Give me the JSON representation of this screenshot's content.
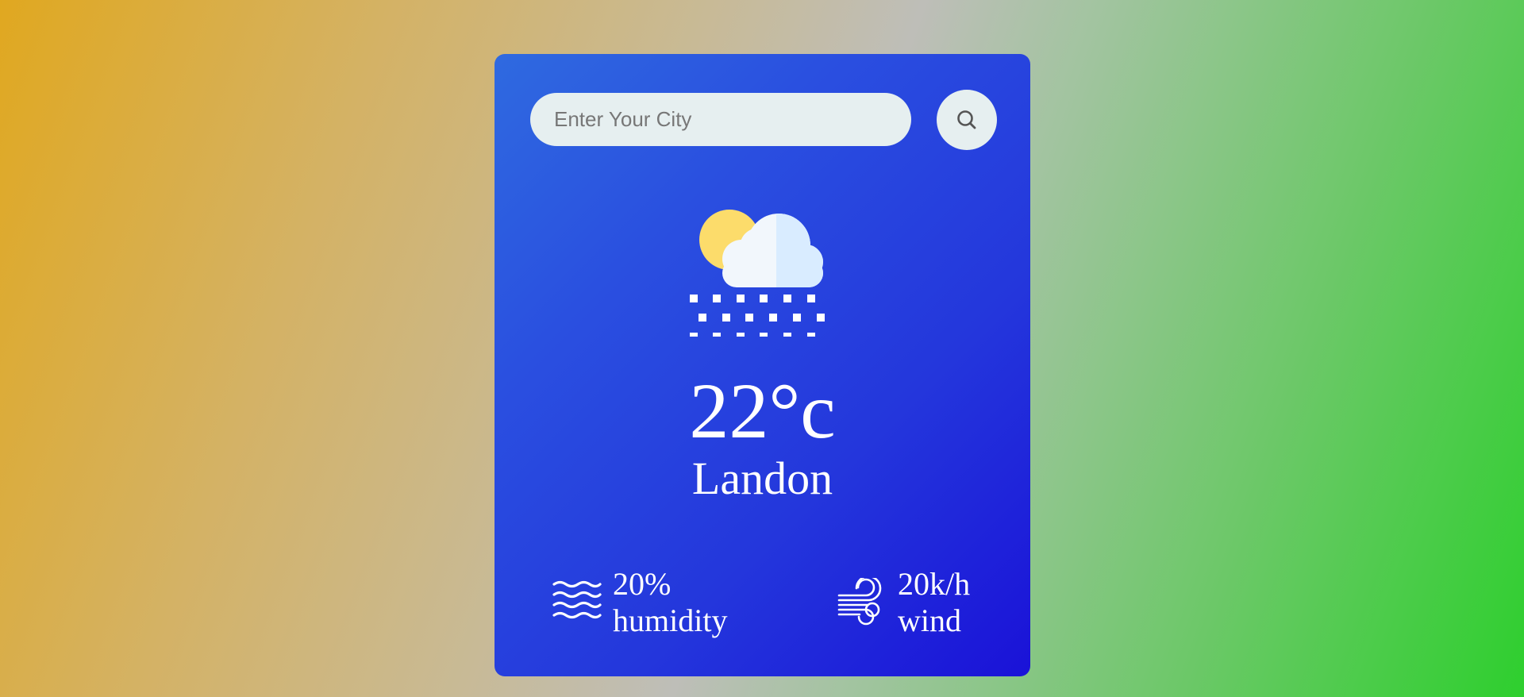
{
  "search": {
    "placeholder": "Enter Your City",
    "button_icon": "search-icon"
  },
  "weather": {
    "icon": "cloud-sun-snow-icon",
    "temperature": "22°c",
    "city": "Landon"
  },
  "details": {
    "humidity": {
      "icon": "humidity-waves-icon",
      "value": "20%",
      "label": "humidity"
    },
    "wind": {
      "icon": "wind-icon",
      "value": "20k/h",
      "label": "wind"
    }
  },
  "colors": {
    "card_gradient_start": "#2f6ae0",
    "card_gradient_end": "#1a12d8",
    "input_background": "#e6eff0",
    "sun": "#fcdc6b",
    "cloud_light": "#f2f7fc",
    "cloud_shade": "#d9ecff"
  }
}
